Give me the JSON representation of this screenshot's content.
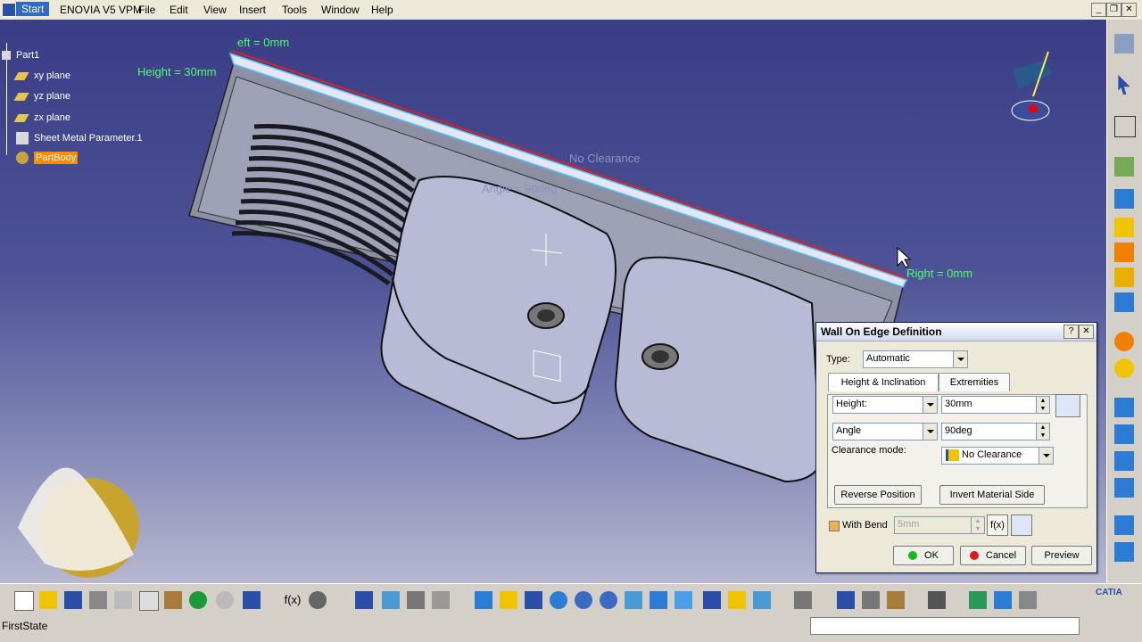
{
  "menubar": {
    "start": "Start",
    "items": [
      "ENOVIA V5 VPM",
      "File",
      "Edit",
      "View",
      "Insert",
      "Tools",
      "Window",
      "Help"
    ]
  },
  "tree": {
    "root": "Part1",
    "nodes": [
      "xy plane",
      "yz plane",
      "zx plane",
      "Sheet Metal Parameter.1",
      "PartBody"
    ]
  },
  "annotations": {
    "left": "eft = 0mm",
    "height": "Height = 30mm",
    "clearance": "No Clearance",
    "angle": "Angle = 90deg",
    "right": "Right = 0mm"
  },
  "dialog": {
    "title": "Wall On Edge Definition",
    "type_label": "Type:",
    "type_value": "Automatic",
    "tabs": [
      "Height & Inclination",
      "Extremities"
    ],
    "height_mode": "Height:",
    "height_value": "30mm",
    "angle_mode": "Angle",
    "angle_value": "90deg",
    "clearance_label": "Clearance mode:",
    "clearance_value": "No Clearance",
    "reverse_button": "Reverse Position",
    "invert_button": "Invert Material Side",
    "with_bend_label": "With Bend",
    "bend_value": "5mm",
    "ok": "OK",
    "cancel": "Cancel",
    "preview": "Preview"
  },
  "status": {
    "text": "FirstState"
  },
  "brand": {
    "logo_text": "CATIA"
  }
}
